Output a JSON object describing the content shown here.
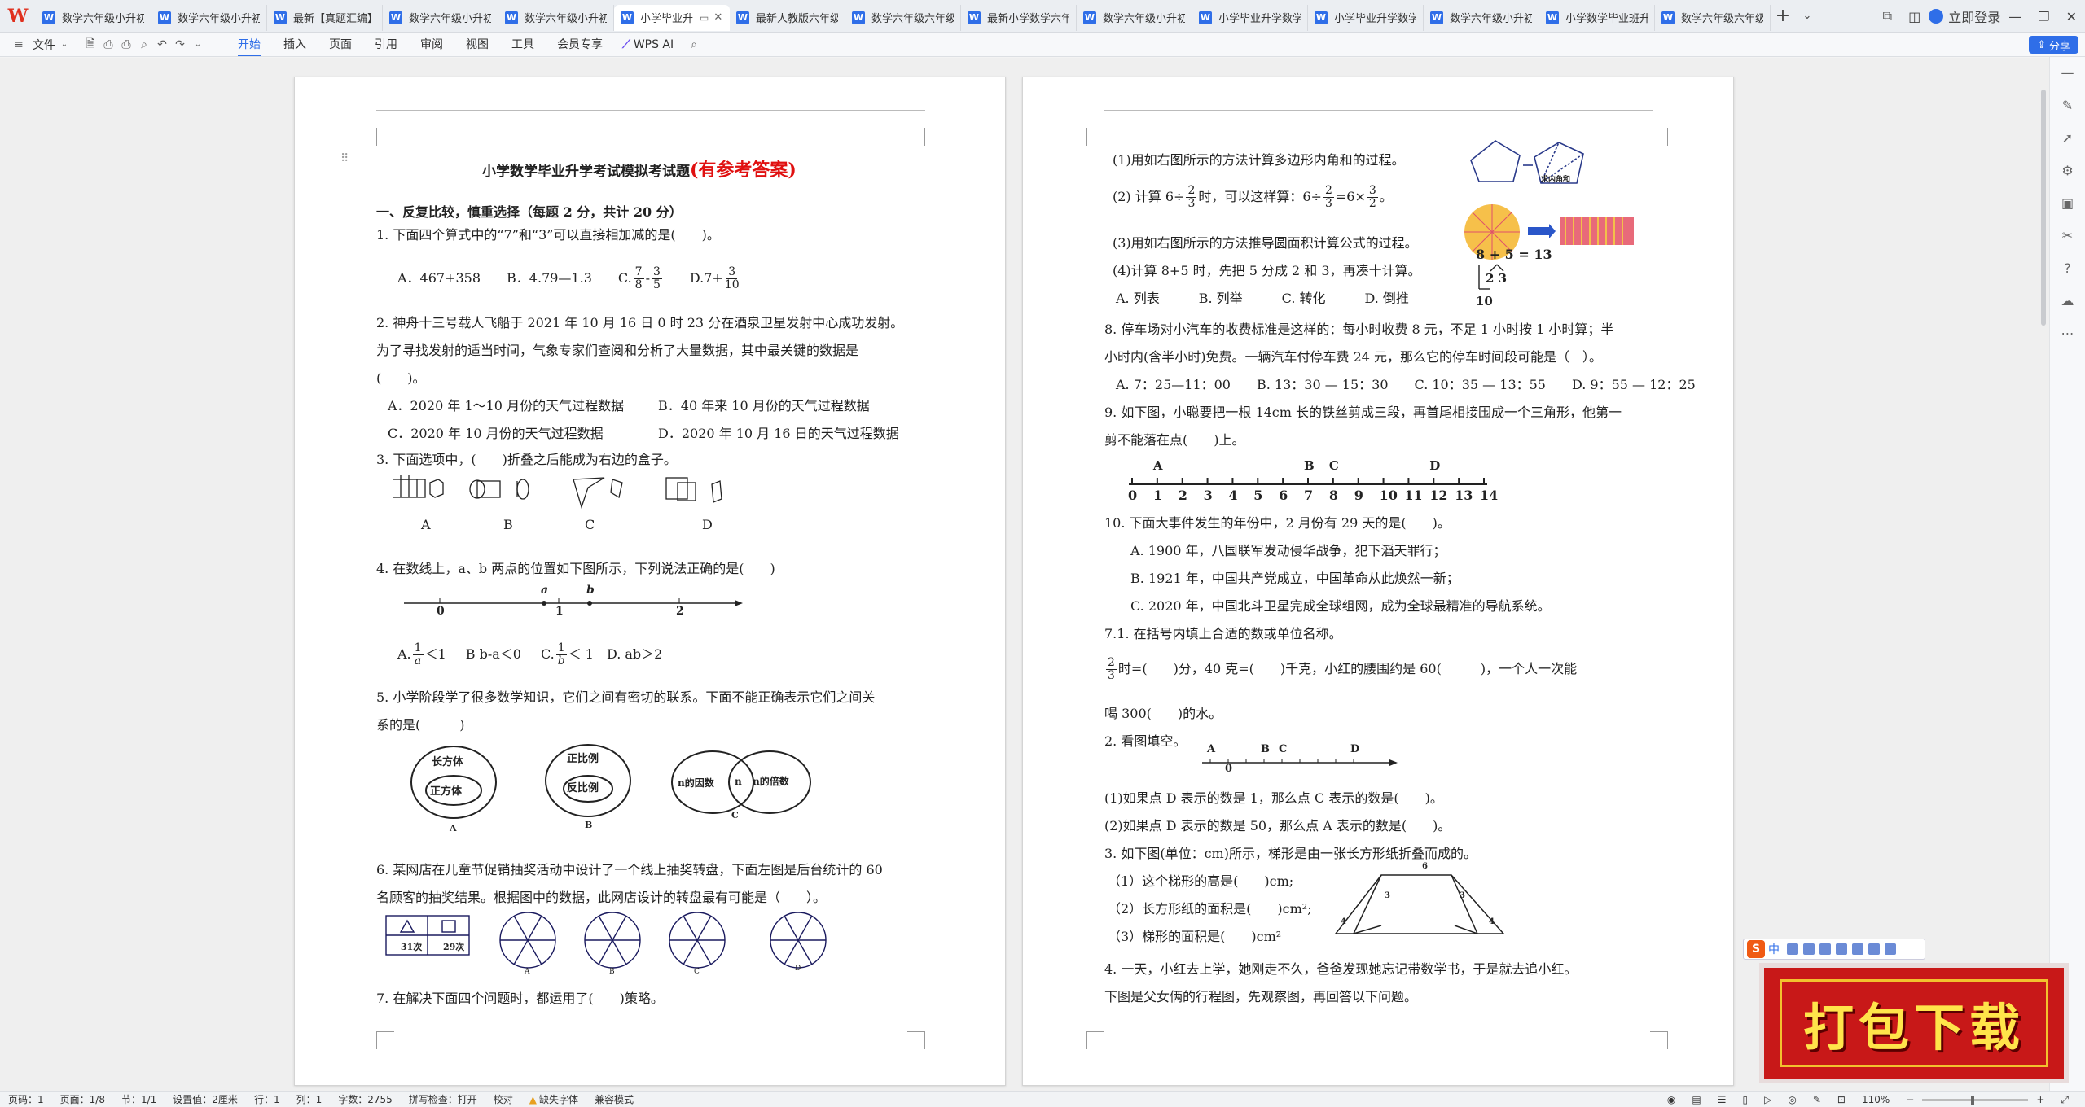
{
  "app": {
    "logo": "W"
  },
  "tabs": [
    {
      "label": "数学六年级小升初"
    },
    {
      "label": "数学六年级小升初"
    },
    {
      "label": "最新【真题汇编】"
    },
    {
      "label": "数学六年级小升初"
    },
    {
      "label": "数学六年级小升初"
    },
    {
      "label": "小学毕业升",
      "active": true
    },
    {
      "label": "最新人教版六年级"
    },
    {
      "label": "数学六年级六年级"
    },
    {
      "label": "最新小学数学六年"
    },
    {
      "label": "数学六年级小升初"
    },
    {
      "label": "小学毕业升学数学"
    },
    {
      "label": "小学毕业升学数学"
    },
    {
      "label": "数学六年级小升初"
    },
    {
      "label": "小学数学毕业班升"
    },
    {
      "label": "数学六年级六年级"
    }
  ],
  "titlebar": {
    "login": "立即登录"
  },
  "ribbon": {
    "file": "文件",
    "tabs": [
      "开始",
      "插入",
      "页面",
      "引用",
      "审阅",
      "视图",
      "工具",
      "会员专享"
    ],
    "active": "开始",
    "ai": "WPS AI",
    "share": "分享"
  },
  "doc": {
    "title": "小学数学毕业升学考试模拟考试题",
    "title_red": "(有参考答案)",
    "section1": "一、反复比较，慎重选择（每题 2 分，共计 20 分）",
    "q1": "1. 下面四个算式中的“7”和“3”可以直接相加减的是(　　)。",
    "q1a": "A．467+358",
    "q1b": "B．4.79—1.3",
    "q1c": "C.",
    "q1c_n1": "7",
    "q1c_d1": "8",
    "q1c_n2": "3",
    "q1c_d2": "5",
    "q1d": "D.7+",
    "q1d_n": "3",
    "q1d_d": "10",
    "q2_l1": "2. 神舟十三号载人飞船于 2021 年 10 月 16 日 0 时 23 分在酒泉卫星发射中心成功发射。",
    "q2_l2": "为了寻找发射的适当时间，气象专家们查阅和分析了大量数据，其中最关键的数据是",
    "q2_l3": "(　　)。",
    "q2a": "A．2020 年 1～10 月份的天气过程数据",
    "q2b": "B．40 年来 10 月份的天气过程数据",
    "q2c": "C．2020 年 10 月份的天气过程数据",
    "q2d": "D．2020 年 10 月 16 日的天气过程数据",
    "q3": "3. 下面选项中，(　　)折叠之后能成为右边的盒子。",
    "q3_opts": [
      "A",
      "B",
      "C",
      "D"
    ],
    "q4": "4. 在数线上，a、b 两点的位置如下图所示，下列说法正确的是(　　)",
    "q4_ticks": [
      "0",
      "1",
      "2"
    ],
    "q4_pts": [
      "a",
      "b"
    ],
    "q4a": "A.",
    "q4a_n": "1",
    "q4a_d": "a",
    "q4a_t": "＜1",
    "q4b": "B  b-a＜0",
    "q4c": "C.",
    "q4c_n": "1",
    "q4c_d": "b",
    "q4c_t": "＜ 1",
    "q4d": "D.  ab＞2",
    "q5_l1": "5. 小学阶段学了很多数学知识，它们之间有密切的联系。下面不能正确表示它们之间关",
    "q5_l2": "系的是(　　　)",
    "q5_v": {
      "outer_a": "长方体",
      "inner_a": "正方体",
      "outer_b": "正比例",
      "inner_b": "反比例",
      "left_c": "n的因数",
      "mid_c": "n",
      "right_c": "n的倍数",
      "la": "A",
      "lb": "B",
      "lc": "C"
    },
    "q6_l1": "6. 某网店在儿童节促销抽奖活动中设计了一个线上抽奖转盘，下面左图是后台统计的 60",
    "q6_l2": "名顾客的抽奖结果。根据图中的数据，此网店设计的转盘最有可能是（　　）。",
    "q6_counts": [
      "31次",
      "29次"
    ],
    "q6_opts": [
      "A",
      "B",
      "C",
      "D"
    ],
    "q7": "7. 在解决下面四个问题时，都运用了(　　)策略。",
    "p2_1": "(1)用如右图所示的方法计算多边形内角和的过程。",
    "p2_2a": "(2) 计算 6÷",
    "p2_2n": "2",
    "p2_2d": "3",
    "p2_2b": "时，可以这样算：6÷",
    "p2_2c": "=6×",
    "p2_2n2": "3",
    "p2_2d2": "2",
    "p2_2e": "。",
    "p2_3": "(3)用如右图所示的方法推导圆面积计算公式的过程。",
    "p2_4": "(4)计算 8+5 时，先把 5 分成 2 和 3，再凑十计算。",
    "p2_4opts": "A. 列表　　　B. 列举　　　C. 转化　　　D. 倒推",
    "p2_poly_label": "求内角和",
    "p2_eq": "8 + 5 = 13",
    "p2_split": "2  3",
    "p2_ten": "10",
    "q8_l1": "8. 停车场对小汽车的收费标准是这样的：每小时收费 8 元，不足 1 小时按 1 小时算；半",
    "q8_l2": "小时内(含半小时)免费。一辆汽车付停车费 24 元，那么它的停车时间段可能是（　）。",
    "q8_opts": "A. 7：25—11：00　　B. 13：30 — 15：30　　C. 10：35 — 13：55　　D. 9：55 — 12：25",
    "q9_l1": "9. 如下图，小聪要把一根 14cm 长的铁丝剪成三段，再首尾相接围成一个三角形，他第一",
    "q9_l2": "剪不能落在点(　　)上。",
    "q9_labels": [
      "A",
      "B",
      "C",
      "D"
    ],
    "q9_ticks": [
      "0",
      "1",
      "2",
      "3",
      "4",
      "5",
      "6",
      "7",
      "8",
      "9",
      "10",
      "11",
      "12",
      "13",
      "14"
    ],
    "q10": "10. 下面大事件发生的年份中，2 月份有 29 天的是(　　)。",
    "q10a": "A. 1900 年，八国联军发动侵华战争，犯下滔天罪行；",
    "q10b": "B. 1921 年，中国共产党成立，中国革命从此焕然一新；",
    "q10c": "C. 2020 年，中国北斗卫星完成全球组网，成为全球最精准的导航系统。",
    "s7_1": "7.1. 在括号内填上合适的数或单位名称。",
    "s7_1b_n": "2",
    "s7_1b_d": "3",
    "s7_1b": "时=(　　)分，40 克=(　　)千克，小红的腰围约是 60(　　　)，一个人一次能",
    "s7_1c": "喝 300(　　)的水。",
    "s7_2": "2. 看图填空。",
    "s7_2_labels": [
      "A",
      "B",
      "C",
      "D"
    ],
    "s7_2_zero": "0",
    "s7_2a": "(1)如果点 D 表示的数是 1，那么点 C 表示的数是(　　)。",
    "s7_2b": "(2)如果点 D 表示的数是 50，那么点 A 表示的数是(　　)。",
    "s7_3": "3. 如下图(单位：cm)所示，梯形是由一张长方形纸折叠而成的。",
    "s7_3a": "（1）这个梯形的高是(　　)cm;",
    "s7_3b": "（2）长方形纸的面积是(　　)cm²;",
    "s7_3c": "（3）梯形的面积是(　　)cm²",
    "s7_3_dims": {
      "top": "6",
      "a": "3",
      "b": "4",
      "c": "3",
      "d": "4"
    },
    "s7_4_l1": "4. 一天，小红去上学，她刚走不久，爸爸发现她忘记带数学书，于是就去追小红。",
    "s7_4_l2": "下图是父女俩的行程图，先观察图，再回答以下问题。"
  },
  "status": {
    "page": "页码：1",
    "pages": "页面：1/8",
    "section": "节：1/1",
    "setting": "设置值：2厘米",
    "row": "行：1",
    "col": "列：1",
    "words": "字数：2755",
    "spell": "拼写检查：打开",
    "proof": "校对",
    "missing_font": "缺失字体",
    "compat": "兼容模式",
    "zoom": "110%"
  },
  "ime": {
    "logo": "S",
    "lang": "中"
  },
  "overlay": {
    "download": "打包下载"
  },
  "colors": {
    "accent": "#2f6ee8",
    "red": "#e01010",
    "badge": "#c81818",
    "badge_text": "#ffe44a"
  }
}
